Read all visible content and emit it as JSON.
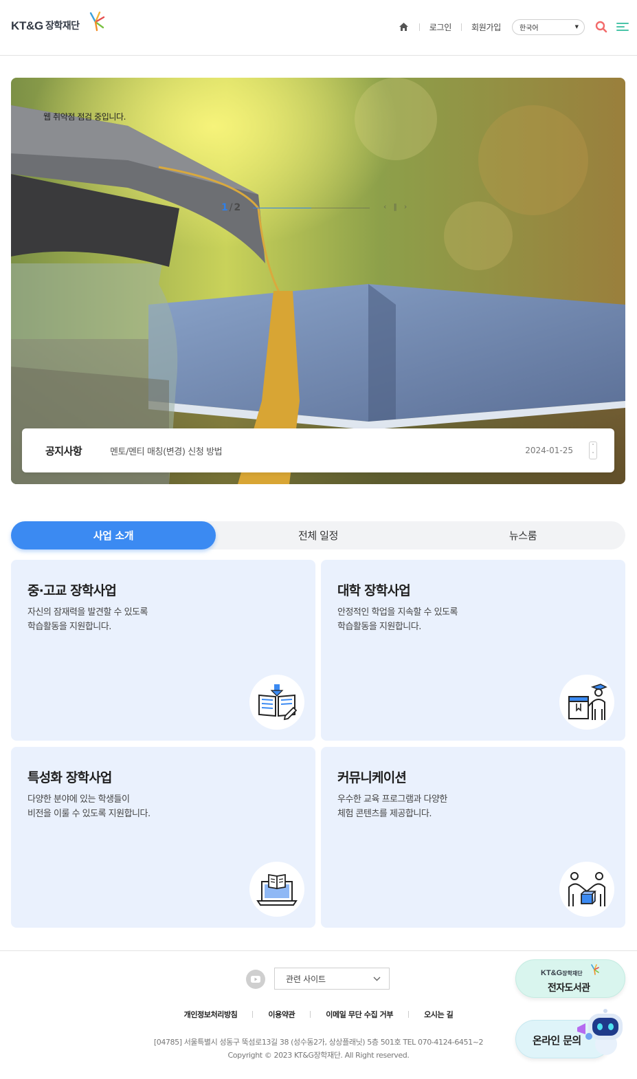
{
  "header": {
    "logo_text": "KT&G",
    "logo_suffix": "장학재단",
    "nav": {
      "login": "로그인",
      "signup": "회원가입",
      "language": "한국어"
    },
    "icons": [
      "home-icon",
      "search-icon",
      "menu-icon"
    ],
    "accent_search": "#f26a6a",
    "accent_menu": "#49c4a8"
  },
  "hero": {
    "notice_text": "웹 취약점 점검 중입니다.",
    "pager_current": "1",
    "pager_total": "2",
    "progress": 0.5,
    "notice_bar": {
      "label": "공지사항",
      "title": "멘토/멘티 매칭(변경) 신청 방법",
      "date": "2024-01-25"
    }
  },
  "tabs": [
    {
      "label": "사업 소개",
      "active": true
    },
    {
      "label": "전체 일정",
      "active": false
    },
    {
      "label": "뉴스룸",
      "active": false
    }
  ],
  "cards": [
    {
      "title": "중·고교 장학사업",
      "desc_line1": "자신의 잠재력을 발견할 수 있도록",
      "desc_line2": "학습활동을 지원합니다.",
      "icon": "book-download-icon"
    },
    {
      "title": "대학 장학사업",
      "desc_line1": "안정적인 학업을 지속할 수 있도록",
      "desc_line2": "학습활동을 지원합니다.",
      "icon": "graduate-icon"
    },
    {
      "title": "특성화 장학사업",
      "desc_line1": "다양한 분야에 있는 학생들이",
      "desc_line2": "비전을 이룰 수 있도록 지원합니다.",
      "icon": "laptop-book-icon"
    },
    {
      "title": "커뮤니케이션",
      "desc_line1": "우수한 교육 프로그램과 다양한",
      "desc_line2": "체험 콘텐츠를 제공합니다.",
      "icon": "people-handshake-icon"
    }
  ],
  "footer": {
    "related_sites": "관련 사이트",
    "links": [
      "개인정보처리방침",
      "이용약관",
      "이메일 무단 수집 거부",
      "오시는 길"
    ],
    "address": "[04785] 서울특별시 성동구 뚝섬로13길 38 (성수동2가, 상상플래닛) 5층 501호 TEL 070-4124-6451~2",
    "copyright": "Copyright © 2023 KT&G장학재단. All Right reserved."
  },
  "floating": {
    "library_logo": "KT&G",
    "library_logo_suffix": "장학재단",
    "library_label": "전자도서관",
    "chat_label": "온라인 문의"
  },
  "colors": {
    "primary": "#3b8af2",
    "card_bg": "#eaf1fd",
    "library_bg": "#d9f5ee",
    "chat_bg": "#dff4f9"
  }
}
